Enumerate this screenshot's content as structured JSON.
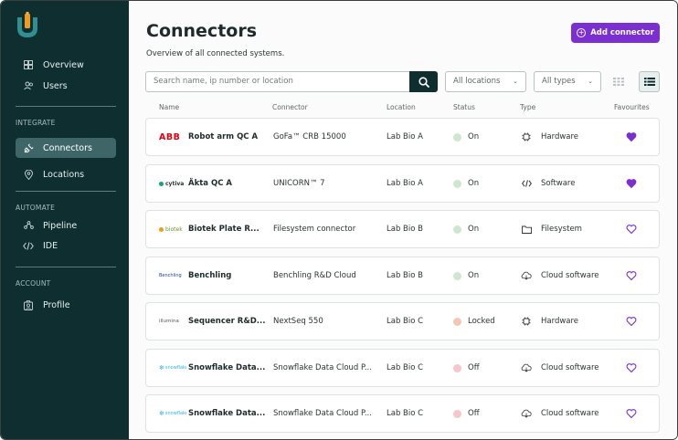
{
  "sidebar": {
    "items": {
      "overview": "Overview",
      "users": "Users",
      "connectors": "Connectors",
      "locations": "Locations",
      "pipeline": "Pipeline",
      "ide": "IDE",
      "profile": "Profile"
    },
    "sections": {
      "integrate": "INTEGRATE",
      "automate": "AUTOMATE",
      "account": "ACCOUNT"
    },
    "active": "Connectors"
  },
  "header": {
    "title": "Connectors",
    "subtitle": "Overview of all connected systems.",
    "add_label": "Add connector"
  },
  "filters": {
    "search_placeholder": "Search name, ip number or location",
    "location_select": "All locations",
    "type_select": "All types",
    "view_mode": "list"
  },
  "table": {
    "columns": [
      "Name",
      "Connector",
      "Location",
      "Status",
      "Type",
      "Favourites"
    ],
    "rows": [
      {
        "brand": "ABB",
        "name": "Robot arm QC A",
        "connector": "GoFa™ CRB 15000",
        "location": "Lab Bio A",
        "status": "On",
        "type": "Hardware",
        "type_icon": "chip-icon",
        "favourite": true
      },
      {
        "brand": "cytiva",
        "name": "Äkta QC A",
        "connector": "UNICORN™ 7",
        "location": "Lab Bio A",
        "status": "On",
        "type": "Software",
        "type_icon": "code-icon",
        "favourite": true
      },
      {
        "brand": "biotek",
        "name": "Biotek Plate R...",
        "connector": "Filesystem connector",
        "location": "Lab Bio B",
        "status": "On",
        "type": "Filesystem",
        "type_icon": "folder-icon",
        "favourite": false
      },
      {
        "brand": "Benchling",
        "name": "Benchling",
        "connector": "Benchling R&D Cloud",
        "location": "Lab Bio B",
        "status": "On",
        "type": "Cloud software",
        "type_icon": "cloud-icon",
        "favourite": false
      },
      {
        "brand": "illumina",
        "name": "Sequencer R&D...",
        "connector": "NextSeq 550",
        "location": "Lab Bio C",
        "status": "Locked",
        "type": "Hardware",
        "type_icon": "chip-icon",
        "favourite": false
      },
      {
        "brand": "snowflake",
        "name": "Snowflake Data...",
        "connector": "Snowflake Data Cloud P...",
        "location": "Lab Bio C",
        "status": "Off",
        "type": "Cloud software",
        "type_icon": "cloud-icon",
        "favourite": false
      },
      {
        "brand": "snowflake",
        "name": "Snowflake Data...",
        "connector": "Snowflake Data Cloud P...",
        "location": "Lab Bio C",
        "status": "Off",
        "type": "Cloud software",
        "type_icon": "cloud-icon",
        "favourite": false
      }
    ]
  },
  "colors": {
    "sidebar_bg": "#0e2e30",
    "accent": "#7b2fd0",
    "status_on": "#cfe6cf",
    "status_locked": "#f2c9b0",
    "status_off": "#f6c6cc",
    "brand_abb": "#e3000f",
    "brand_snowflake": "#29b5e8"
  }
}
